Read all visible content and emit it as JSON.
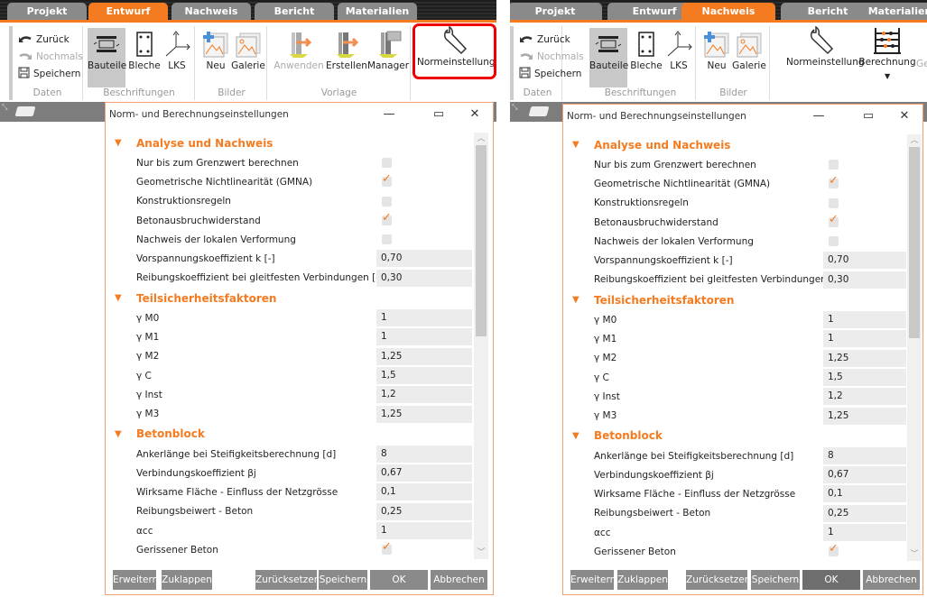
{
  "panels": [
    {
      "tabs": [
        {
          "label": "Projekt"
        },
        {
          "label": "Entwurf",
          "active": true
        },
        {
          "label": "Nachweis"
        },
        {
          "label": "Bericht"
        },
        {
          "label": "Materialien"
        }
      ],
      "ribbon": {
        "daten": {
          "zurueck": "Zurück",
          "nochmals": "Nochmals",
          "speichern": "Speichern",
          "label": "Daten"
        },
        "beschriftungen": {
          "bauteile": "Bauteile",
          "bleche": "Bleche",
          "lks": "LKS",
          "label": "Beschriftungen"
        },
        "bilder": {
          "neu": "Neu",
          "galerie": "Galerie",
          "label": "Bilder"
        },
        "vorlage": {
          "anwenden": "Anwenden",
          "erstellen": "Erstellen",
          "manager": "Manager",
          "label": "Vorlage"
        },
        "normeinstellung": "Normeinstellung"
      },
      "dialog": {
        "title": "Norm- und Berechnungseinstellungen",
        "sections": [
          {
            "title": "Analyse und Nachweis",
            "rows": [
              {
                "label": "Nur bis zum Grenzwert berechnen",
                "checked": false
              },
              {
                "label": "Geometrische Nichtlinearität (GMNA)",
                "checked": true
              },
              {
                "label": "Konstruktionsregeln",
                "checked": false
              },
              {
                "label": "Betonausbruchwiderstand",
                "checked": true
              },
              {
                "label": "Nachweis der lokalen Verformung",
                "checked": false
              },
              {
                "label": "Vorspannungskoeffizient k [-]",
                "value": "0,70"
              },
              {
                "label": "Reibungskoeffizient bei gleitfesten Verbindungen [-]",
                "value": "0,30"
              }
            ]
          },
          {
            "title": "Teilsicherheitsfaktoren",
            "rows": [
              {
                "label": "γ M0",
                "value": "1"
              },
              {
                "label": "γ M1",
                "value": "1"
              },
              {
                "label": "γ M2",
                "value": "1,25"
              },
              {
                "label": "γ C",
                "value": "1,5"
              },
              {
                "label": "γ Inst",
                "value": "1,2"
              },
              {
                "label": "γ M3",
                "value": "1,25"
              }
            ]
          },
          {
            "title": "Betonblock",
            "rows": [
              {
                "label": "Ankerlänge bei Steifigkeitsberechnung [d]",
                "value": "8"
              },
              {
                "label": "Verbindungskoeffizient βj",
                "value": "0,67"
              },
              {
                "label": "Wirksame Fläche - Einfluss der Netzgrösse",
                "value": "0,1"
              },
              {
                "label": "Reibungsbeiwert - Beton",
                "value": "0,25"
              },
              {
                "label": "αcc",
                "value": "1"
              },
              {
                "label": "Gerissener Beton",
                "checked": true
              }
            ]
          }
        ],
        "buttons": {
          "erweitern": "Erweitern",
          "zuklappen": "Zuklappen",
          "zuruecksetzen": "Zurücksetzen",
          "speichern": "Speichern",
          "ok": "OK",
          "abbrechen": "Abbrechen"
        }
      }
    },
    {
      "tabs": [
        {
          "label": "Projekt"
        },
        {
          "label": "Entwurf"
        },
        {
          "label": "Nachweis",
          "active": true
        },
        {
          "label": "Bericht"
        },
        {
          "label": "Materialien"
        }
      ],
      "ribbon": {
        "daten": {
          "zurueck": "Zurück",
          "nochmals": "Nochmals",
          "speichern": "Speichern",
          "label": "Daten"
        },
        "beschriftungen": {
          "bauteile": "Bauteile",
          "bleche": "Bleche",
          "lks": "LKS",
          "label": "Beschriftungen"
        },
        "bilder": {
          "neu": "Neu",
          "galerie": "Galerie",
          "label": "Bilder"
        },
        "normeinstellung": "Normeinstellung",
        "berechnung": "Berechnung",
        "cut": "Ge"
      },
      "dialog": {
        "title": "Norm- und Berechnungseinstellungen",
        "sections": [
          {
            "title": "Analyse und Nachweis",
            "rows": [
              {
                "label": "Nur bis zum Grenzwert berechnen",
                "checked": false
              },
              {
                "label": "Geometrische Nichtlinearität (GMNA)",
                "checked": true
              },
              {
                "label": "Konstruktionsregeln",
                "checked": false
              },
              {
                "label": "Betonausbruchwiderstand",
                "checked": true
              },
              {
                "label": "Nachweis der lokalen Verformung",
                "checked": false
              },
              {
                "label": "Vorspannungskoeffizient k [-]",
                "value": "0,70"
              },
              {
                "label": "Reibungskoeffizient bei gleitfesten Verbindungen [-",
                "value": "0,30"
              }
            ]
          },
          {
            "title": "Teilsicherheitsfaktoren",
            "rows": [
              {
                "label": "γ M0",
                "value": "1"
              },
              {
                "label": "γ M1",
                "value": "1"
              },
              {
                "label": "γ M2",
                "value": "1,25"
              },
              {
                "label": "γ C",
                "value": "1,5"
              },
              {
                "label": "γ Inst",
                "value": "1,2"
              },
              {
                "label": "γ M3",
                "value": "1,25"
              }
            ]
          },
          {
            "title": "Betonblock",
            "rows": [
              {
                "label": "Ankerlänge bei Steifigkeitsberechnung [d]",
                "value": "8"
              },
              {
                "label": "Verbindungskoeffizient βj",
                "value": "0,67"
              },
              {
                "label": "Wirksame Fläche - Einfluss der Netzgrösse",
                "value": "0,1"
              },
              {
                "label": "Reibungsbeiwert - Beton",
                "value": "0,25"
              },
              {
                "label": "αcc",
                "value": "1"
              },
              {
                "label": "Gerissener Beton",
                "checked": true
              }
            ]
          }
        ],
        "buttons": {
          "erweitern": "Erweitern",
          "zuklappen": "Zuklappen",
          "zuruecksetzen": "Zurücksetzen",
          "speichern": "Speichern",
          "ok": "OK",
          "abbrechen": "Abbrechen"
        }
      }
    }
  ],
  "colors": {
    "accent": "#f47b20",
    "highlight": "#e00000"
  }
}
